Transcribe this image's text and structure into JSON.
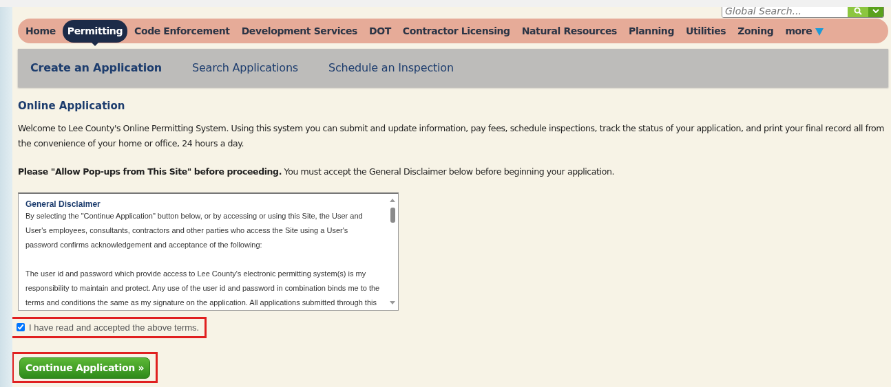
{
  "search": {
    "placeholder": "Global Search..."
  },
  "nav": [
    {
      "label": "Home",
      "selected": false
    },
    {
      "label": "Permitting",
      "selected": true
    },
    {
      "label": "Code Enforcement",
      "selected": false
    },
    {
      "label": "Development Services",
      "selected": false
    },
    {
      "label": "DOT",
      "selected": false
    },
    {
      "label": "Contractor Licensing",
      "selected": false
    },
    {
      "label": "Natural Resources",
      "selected": false
    },
    {
      "label": "Planning",
      "selected": false
    },
    {
      "label": "Utilities",
      "selected": false
    },
    {
      "label": "Zoning",
      "selected": false
    }
  ],
  "nav_more": "more",
  "subnav": [
    {
      "label": "Create an Application",
      "selected": true
    },
    {
      "label": "Search Applications",
      "selected": false
    },
    {
      "label": "Schedule an Inspection",
      "selected": false
    }
  ],
  "heading": "Online Application",
  "intro": "Welcome to Lee County's Online Permitting System. Using this system you can submit and update information, pay fees, schedule inspections, track the status of your application, and print your final record all from the convenience of your home or office, 24 hours a day.",
  "notice": "**Please \"Allow Pop-ups from This Site\" before proceeding.** You must accept the General Disclaimer below before beginning your application.",
  "disclaimer": {
    "title": "General Disclaimer",
    "paragraphs": [
      "By selecting the \"Continue Application\" button below, or by accessing or using this Site, the User and User's employees, consultants, contractors and other parties who access the Site using a User's password confirms acknowledgement and acceptance of the following:",
      "The user id and password which provide access to Lee County's electronic permitting system(s) is my responsibility to maintain and protect. Any use of the user id and password in combination binds me to the terms and conditions the same as my signature on the application. All applications submitted through this"
    ]
  },
  "accept": {
    "label": "I have read and accepted the above terms.",
    "checked": true,
    "highlighted": true
  },
  "continue_button": {
    "label": "Continue Application »",
    "highlighted": true
  }
}
